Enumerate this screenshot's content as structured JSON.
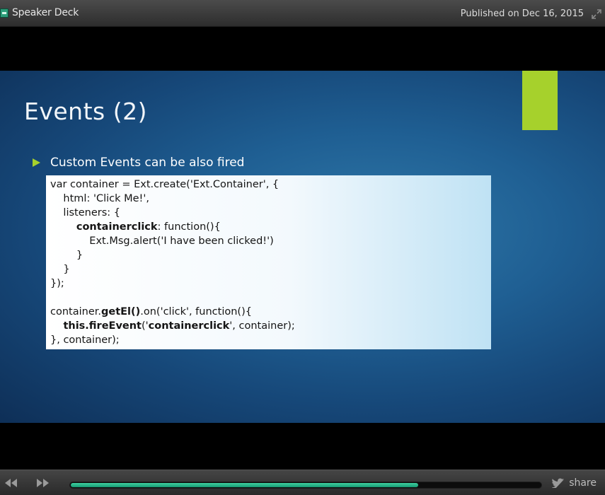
{
  "topbar": {
    "brand": "Speaker Deck",
    "published": "Published on Dec 16, 2015"
  },
  "slide": {
    "title": "Events (2)",
    "bullet": "Custom Events can be also fired",
    "accent_color": "#a6d12c",
    "code_lines": [
      [
        {
          "t": "var container = Ext.create('Ext.Container', {"
        }
      ],
      [
        {
          "t": "    html: 'Click Me!',"
        }
      ],
      [
        {
          "t": "    listeners: {"
        }
      ],
      [
        {
          "t": "        "
        },
        {
          "t": "containerclick",
          "b": true
        },
        {
          "t": ": function(){"
        }
      ],
      [
        {
          "t": "            Ext.Msg.alert('I have been clicked!')"
        }
      ],
      [
        {
          "t": "        }"
        }
      ],
      [
        {
          "t": "    }"
        }
      ],
      [
        {
          "t": "});"
        }
      ],
      [
        {
          "t": ""
        }
      ],
      [
        {
          "t": "container."
        },
        {
          "t": "getEl()",
          "b": true
        },
        {
          "t": ".on('click', function(){"
        }
      ],
      [
        {
          "t": "    "
        },
        {
          "t": "this.fireEvent",
          "b": true
        },
        {
          "t": "('"
        },
        {
          "t": "containerclick",
          "b": true
        },
        {
          "t": "', container);"
        }
      ],
      [
        {
          "t": "}, container);"
        }
      ]
    ]
  },
  "controls": {
    "progress": 0.74,
    "share_label": "share",
    "accent": "#1fae80"
  }
}
